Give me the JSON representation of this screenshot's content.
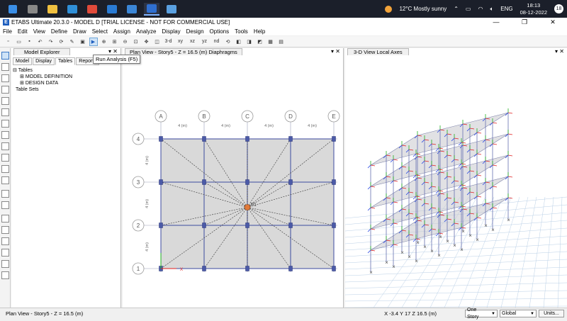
{
  "taskbar": {
    "apps": [
      {
        "name": "start-icon",
        "color": "#3a8ee6"
      },
      {
        "name": "search-icon",
        "color": "#888888"
      },
      {
        "name": "file-explorer-icon",
        "color": "#f0c040"
      },
      {
        "name": "edge-icon",
        "color": "#2f8fd8"
      },
      {
        "name": "chrome-icon",
        "color": "#e04a3a"
      },
      {
        "name": "store-icon",
        "color": "#2a7bd4"
      },
      {
        "name": "mail-icon",
        "color": "#3b86d6"
      },
      {
        "name": "etabs-icon",
        "color": "#2f6fd0"
      },
      {
        "name": "photos-icon",
        "color": "#5aa0e0"
      }
    ],
    "weather": "12°C  Mostly sunny",
    "lang": "ENG",
    "time": "18:13",
    "date": "08-12-2022",
    "notif_count": "18"
  },
  "window": {
    "title": "ETABS Ultimate 20.3.0 - MODEL D  [TRIAL LICENSE - NOT FOR COMMERCIAL USE]",
    "min": "—",
    "max": "❐",
    "close": "✕"
  },
  "menu": [
    "File",
    "Edit",
    "View",
    "Define",
    "Draw",
    "Select",
    "Assign",
    "Analyze",
    "Display",
    "Design",
    "Options",
    "Tools",
    "Help"
  ],
  "toolbar": {
    "tooltip": "Run Analysis (F5)",
    "labels": [
      "3-d",
      "xy",
      "xz",
      "yz",
      "nd"
    ]
  },
  "explorer": {
    "title": "Model Explorer",
    "tabs": [
      "Model",
      "Display",
      "Tables",
      "Reports"
    ],
    "active_tab": "Tables",
    "tree": {
      "root": "Tables",
      "children": [
        "MODEL DEFINITION",
        "DESIGN DATA"
      ],
      "sibling": "Table Sets"
    }
  },
  "plan": {
    "title": "Plan View - Story5 - Z = 16.5 (m)  Diaphragms",
    "columns": [
      "A",
      "B",
      "C",
      "D",
      "E"
    ],
    "rows": [
      "4",
      "3",
      "2",
      "1"
    ],
    "spacing_labels": [
      "4 (m)",
      "4 (m)",
      "4 (m)",
      "4 (m)"
    ],
    "row_spacing_labels": [
      "4 (m)",
      "4 (m)",
      "4 (m)"
    ],
    "diaphragm_label": "D1",
    "axis_x": "X"
  },
  "view3d": {
    "title": "3-D View  Local Axes"
  },
  "status": {
    "left": "Plan View - Story5 - Z = 16.5 (m)",
    "coords": "X -3.4  Y 17  Z 16.5 (m)",
    "story": "One Story",
    "coord_sys": "Global",
    "units": "Units..."
  }
}
